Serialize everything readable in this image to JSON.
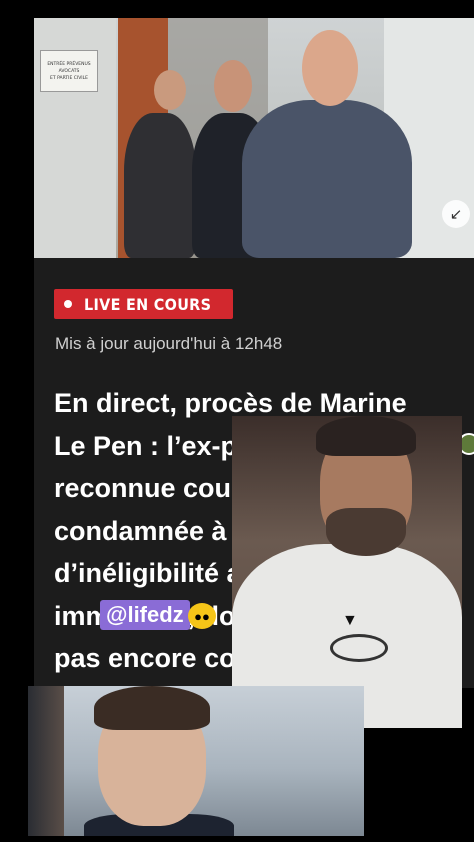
{
  "top_photo": {
    "door_sign_lines": [
      "ENTRÉE PRÉVENUS",
      "AVOCATS",
      "ET PARTIE CIVILE"
    ],
    "expand_icon": "collapse-arrow-icon"
  },
  "article": {
    "badge": "LIVE EN COURS",
    "updated": "Mis à jour aujourd'hui à 12h48",
    "headline_lines": [
      "En direct, procès de Marine",
      "Le Pen : l’ex-présidente du RN",
      "reconnue coupable,",
      "condamnée à une peine",
      "d’inéligibilité avec exécution",
      "immédiate, dont elle n’est",
      "pas encore consciente"
    ]
  },
  "overlay": {
    "watermark": "@lifedz",
    "emoji_icon": "sunglasses-face-icon"
  },
  "colors": {
    "live_red": "#d2282e",
    "article_bg": "#1c1c1c",
    "watermark_bg": "#8a6cd6"
  }
}
